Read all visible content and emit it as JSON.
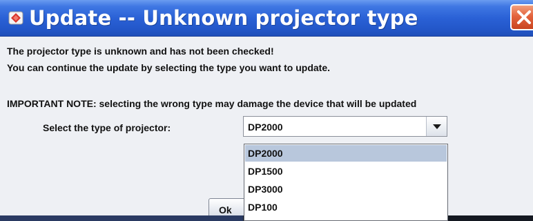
{
  "window": {
    "title": "Update -- Unknown projector type",
    "app_icon": "projector-app-icon",
    "close_icon": "close-icon",
    "titlebar_color": "#2a61d6",
    "close_color": "#e3633d"
  },
  "message": {
    "line1": "The projector type is unknown and has not been checked!",
    "line2": "You can continue the update by selecting the type you want to update.",
    "line3": "IMPORTANT NOTE: selecting the wrong type may damage the device that will be updated"
  },
  "selector": {
    "label": "Select the type of projector:",
    "selected": "DP2000",
    "arrow_icon": "chevron-down-icon",
    "options": [
      "DP2000",
      "DP1500",
      "DP3000",
      "DP100"
    ],
    "highlight_color": "#b8c7dc"
  },
  "buttons": {
    "ok": "Ok"
  }
}
